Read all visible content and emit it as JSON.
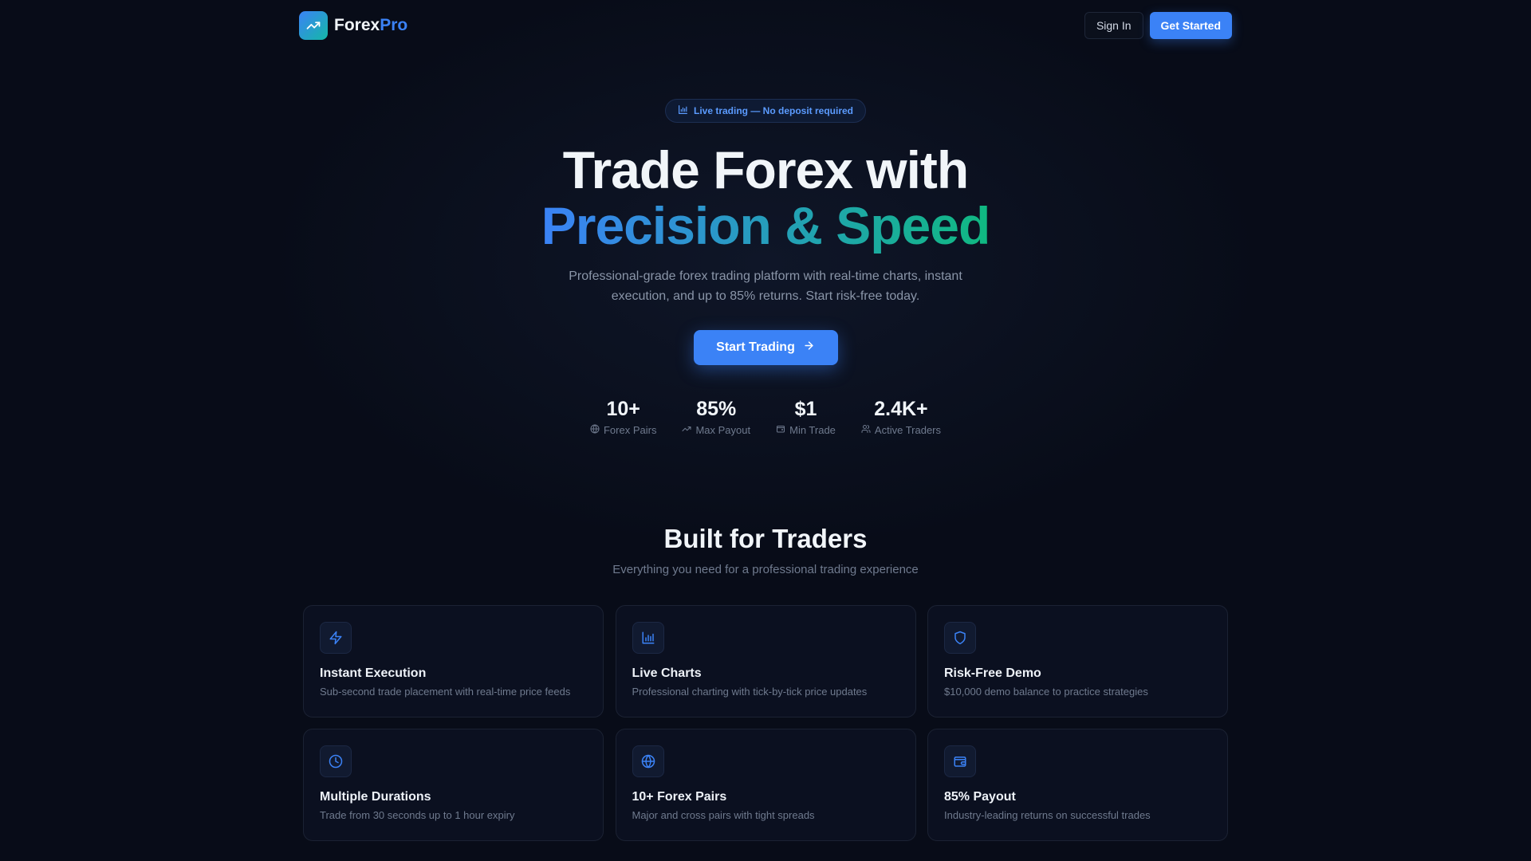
{
  "brand": {
    "name_main": "Forex",
    "name_accent": "Pro",
    "logo_icon": "trending-up-icon"
  },
  "nav": {
    "sign_in": "Sign In",
    "get_started": "Get Started"
  },
  "hero": {
    "badge": "Live trading — No deposit required",
    "title_line1": "Trade Forex with",
    "title_line2": "Precision & Speed",
    "subtitle": "Professional-grade forex trading platform with real-time charts, instant execution, and up to 85% returns. Start risk-free today.",
    "cta": "Start Trading"
  },
  "stats": [
    {
      "value": "10+",
      "label": "Forex Pairs",
      "icon": "globe-icon"
    },
    {
      "value": "85%",
      "label": "Max Payout",
      "icon": "trending-up-icon"
    },
    {
      "value": "$1",
      "label": "Min Trade",
      "icon": "wallet-icon"
    },
    {
      "value": "2.4K+",
      "label": "Active Traders",
      "icon": "users-icon"
    }
  ],
  "features": {
    "title": "Built for Traders",
    "subtitle": "Everything you need for a professional trading experience",
    "items": [
      {
        "title": "Instant Execution",
        "desc": "Sub-second trade placement with real-time price feeds",
        "icon": "zap-icon"
      },
      {
        "title": "Live Charts",
        "desc": "Professional charting with tick-by-tick price updates",
        "icon": "bar-chart-icon"
      },
      {
        "title": "Risk-Free Demo",
        "desc": "$10,000 demo balance to practice strategies",
        "icon": "shield-icon"
      },
      {
        "title": "Multiple Durations",
        "desc": "Trade from 30 seconds up to 1 hour expiry",
        "icon": "clock-icon"
      },
      {
        "title": "10+ Forex Pairs",
        "desc": "Major and cross pairs with tight spreads",
        "icon": "globe-icon"
      },
      {
        "title": "85% Payout",
        "desc": "Industry-leading returns on successful trades",
        "icon": "wallet-icon"
      }
    ]
  },
  "colors": {
    "accent": "#3b82f6",
    "accent_end": "#10b981",
    "background": "#080c18"
  }
}
